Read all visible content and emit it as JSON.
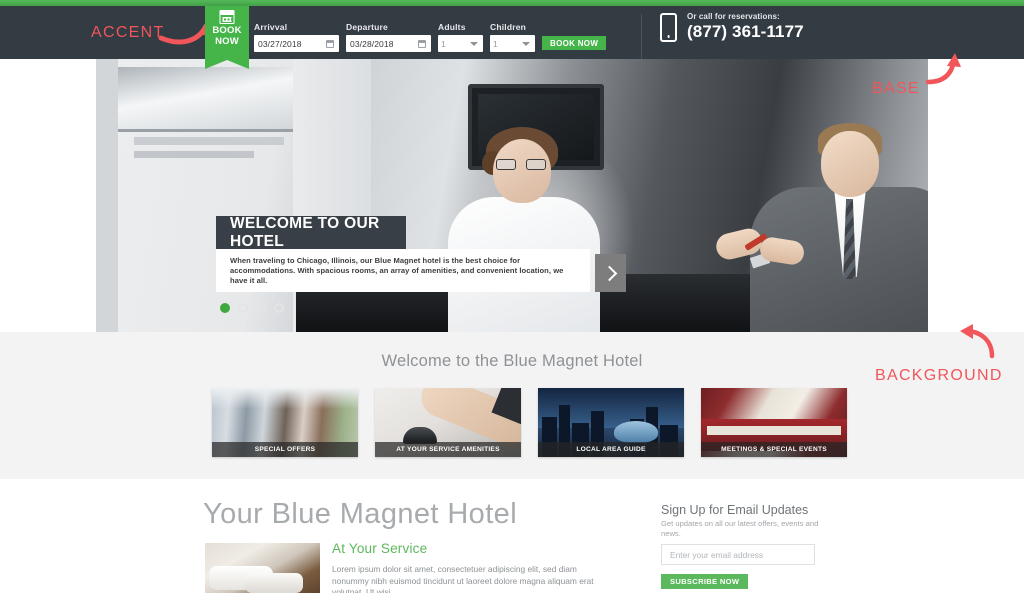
{
  "header": {
    "ribbon": {
      "line1": "BOOK",
      "line2": "NOW",
      "icon": "calendar-icon"
    },
    "form": {
      "arrival_label": "Arrivval",
      "arrival_value": "03/27/2018",
      "departure_label": "Departure",
      "departure_value": "03/28/2018",
      "adults_label": "Adults",
      "adults_value": "1",
      "children_label": "Children",
      "children_value": "1",
      "submit_label": "BOOK NOW"
    },
    "phone": {
      "icon": "mobile-phone-icon",
      "caption": "Or call for reservations:",
      "number": "(877) 361-1177"
    }
  },
  "hero": {
    "title": "WELCOME TO OUR HOTEL",
    "body": "When traveling to Chicago, Illinois, our Blue Magnet hotel is the best choice for accommodations. With spacious rooms, an array of amenities, and convenient location, we have it all.",
    "next_icon": "chevron-right-icon",
    "dots": [
      true,
      false,
      false,
      false
    ]
  },
  "welcome": {
    "title": "Welcome to the Blue Magnet Hotel",
    "cards": [
      {
        "caption": "SPECIAL OFFERS"
      },
      {
        "caption": "AT YOUR SERVICE AMENITIES"
      },
      {
        "caption": "LOCAL AREA GUIDE"
      },
      {
        "caption": "MEETINGS & SPECIAL EVENTS"
      }
    ]
  },
  "content": {
    "title": "Your Blue Magnet Hotel",
    "subtitle": "At Your Service",
    "body": "Lorem ipsum dolor sit amet, consectetuer adipiscing elit, sed diam nonummy nibh euismod tincidunt ut laoreet dolore magna aliquam erat volutpat. Ut wisi"
  },
  "signup": {
    "heading": "Sign Up for Email Updates",
    "subtext": "Get updates on all our latest offers, events and news.",
    "placeholder": "Enter your email address",
    "button_label": "SUBSCRIBE NOW"
  },
  "annotations": {
    "accent": "ACCENT",
    "base": "BASE",
    "background": "BACKGROUND",
    "color": "#f0565a"
  },
  "colors": {
    "accent_green": "#45b449",
    "base_dark": "#333b43",
    "background_gray": "#f3f3f3"
  }
}
